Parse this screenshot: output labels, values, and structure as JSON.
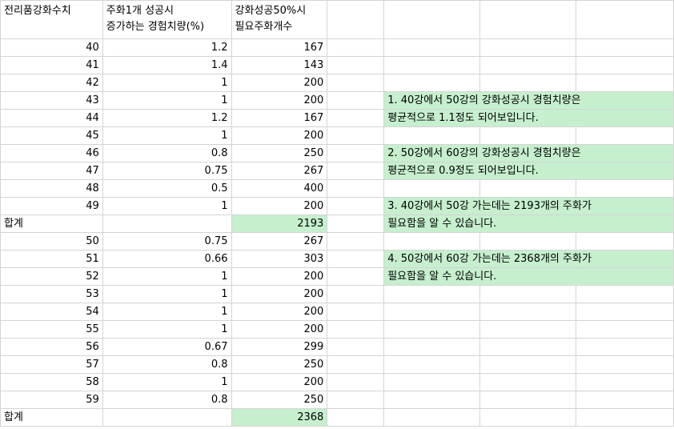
{
  "headers": {
    "col_a": "전리품강화수치",
    "col_b_line1": "주화1개 성공시",
    "col_b_line2": "증가하는 경험치량(%)",
    "col_c_line1": "강화성공50%시",
    "col_c_line2": "필요주화개수"
  },
  "rows": [
    {
      "a": "40",
      "b": "1.2",
      "c": "167"
    },
    {
      "a": "41",
      "b": "1.4",
      "c": "143"
    },
    {
      "a": "42",
      "b": "1",
      "c": "200"
    },
    {
      "a": "43",
      "b": "1",
      "c": "200"
    },
    {
      "a": "44",
      "b": "1.2",
      "c": "167"
    },
    {
      "a": "45",
      "b": "1",
      "c": "200"
    },
    {
      "a": "46",
      "b": "0.8",
      "c": "250"
    },
    {
      "a": "47",
      "b": "0.75",
      "c": "267"
    },
    {
      "a": "48",
      "b": "0.5",
      "c": "400"
    },
    {
      "a": "49",
      "b": "1",
      "c": "200"
    },
    {
      "a": "합계",
      "b": "",
      "c": "2193"
    },
    {
      "a": "50",
      "b": "0.75",
      "c": "267"
    },
    {
      "a": "51",
      "b": "0.66",
      "c": "303"
    },
    {
      "a": "52",
      "b": "1",
      "c": "200"
    },
    {
      "a": "53",
      "b": "1",
      "c": "200"
    },
    {
      "a": "54",
      "b": "1",
      "c": "200"
    },
    {
      "a": "55",
      "b": "1",
      "c": "200"
    },
    {
      "a": "56",
      "b": "0.67",
      "c": "299"
    },
    {
      "a": "57",
      "b": "0.8",
      "c": "250"
    },
    {
      "a": "58",
      "b": "1",
      "c": "200"
    },
    {
      "a": "59",
      "b": "0.8",
      "c": "250"
    },
    {
      "a": "합계",
      "b": "",
      "c": "2368"
    }
  ],
  "notes": {
    "n1_l1": "1.  40강에서 50강의 강화성공시 경험치량은",
    "n1_l2": "평균적으로 1.1정도 되어보입니다.",
    "n2_l1": "2.  50강에서 60강의 강화성공시 경험치량은",
    "n2_l2": "평균적으로 0.9정도 되어보입니다.",
    "n3_l1": "3.  40강에서 50강 가는데는 2193개의 주화가",
    "n3_l2": "필요함을 알 수 있습니다.",
    "n4_l1": "4.  50강에서 60강 가는데는 2368개의 주화가",
    "n4_l2": "필요함을 알 수 있습니다."
  },
  "colors": {
    "highlight": "#c6efce",
    "gridline": "#d4d4d4"
  }
}
